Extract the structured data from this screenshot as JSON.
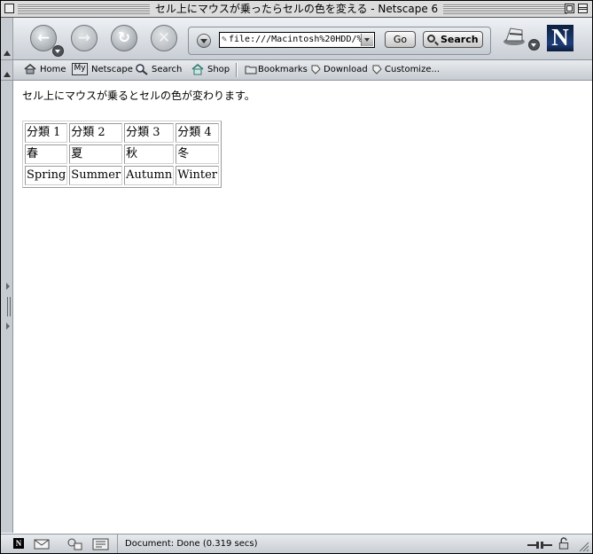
{
  "window": {
    "title": "セル上にマウスが乗ったらセルの色を変える - Netscape 6"
  },
  "nav": {
    "url": "file:///Macintosh%20HDD/%9",
    "go_label": "Go",
    "search_label": "Search",
    "logo_letter": "N"
  },
  "personal_toolbar": {
    "home": "Home",
    "my_badge": "My",
    "netscape": "Netscape",
    "search": "Search",
    "shop": "Shop",
    "bookmarks": "Bookmarks",
    "download": "Download",
    "customize": "Customize..."
  },
  "page": {
    "intro": "セル上にマウスが乗るとセルの色が変わります。",
    "table": [
      [
        "分類 1",
        "分類 2",
        "分類 3",
        "分類 4"
      ],
      [
        "春",
        "夏",
        "秋",
        "冬"
      ],
      [
        "Spring",
        "Summer",
        "Autumn",
        "Winter"
      ]
    ]
  },
  "status": {
    "text": "Document: Done (0.319 secs)",
    "n_badge": "N"
  },
  "colors": {
    "chrome_light": "#eef1f4",
    "chrome_dark": "#c7ccd2",
    "logo_bg": "#0c1e3f",
    "page_bg": "#ffffff"
  }
}
